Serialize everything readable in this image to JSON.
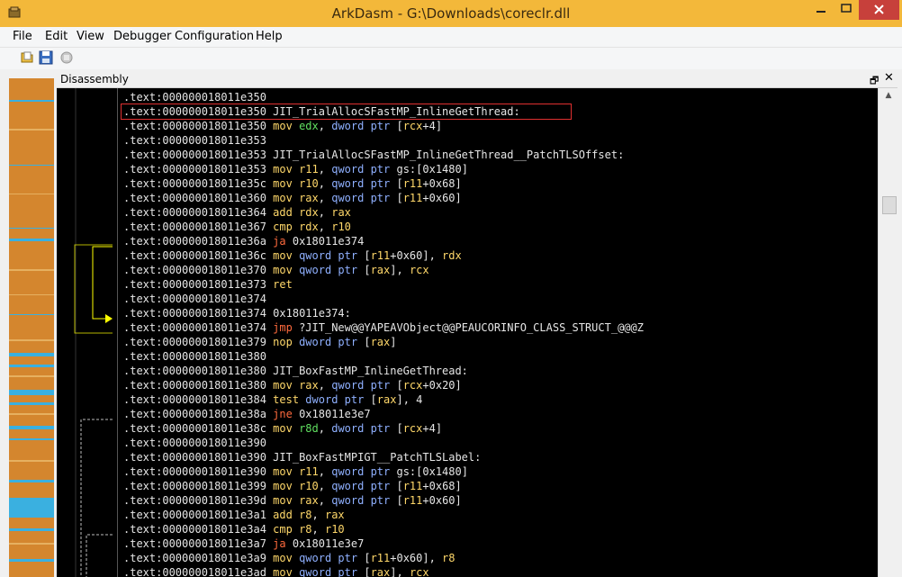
{
  "window": {
    "title": "ArkDasm - G:\\Downloads\\coreclr.dll",
    "minimize_glyph": "—",
    "maximize_glyph": "☐",
    "close_glyph": "✕"
  },
  "menu": {
    "file": "File",
    "edit": "Edit",
    "view": "View",
    "debugger": "Debugger",
    "configuration": "Configuration",
    "help": "Help"
  },
  "toolbar": {
    "icons": [
      "open-icon",
      "save-icon",
      "disabled-icon"
    ]
  },
  "panel": {
    "title": "Disassembly",
    "restore_glyph": "🗗",
    "close_glyph": "✕"
  },
  "colors": {
    "title_bar": "#f3b83a",
    "close_button": "#c7403b",
    "code_background": "#000000",
    "instruction": "#ffd86a",
    "jump": "#ff6a3d",
    "pointer": "#8fb0ff",
    "strip": "#d4862e",
    "strip_accent": "#3ab0e0",
    "highlight_border": "#e03030",
    "graph_arrow": "#ffff00"
  },
  "code_lines": [
    [
      {
        "t": ".text:000000018011e350",
        "c": "addr"
      }
    ],
    [
      {
        "t": ".text:000000018011e350 ",
        "c": "addr"
      },
      {
        "t": "JIT_TrialAllocSFastMP_InlineGetThread:",
        "c": "label"
      }
    ],
    [
      {
        "t": ".text:000000018011e350 ",
        "c": "addr"
      },
      {
        "t": "mov ",
        "c": "instr"
      },
      {
        "t": "edx",
        "c": "green"
      },
      {
        "t": ", ",
        "c": "num"
      },
      {
        "t": "dword ptr ",
        "c": "ptr"
      },
      {
        "t": "[",
        "c": "num"
      },
      {
        "t": "rcx",
        "c": "reg"
      },
      {
        "t": "+4]",
        "c": "num"
      }
    ],
    [
      {
        "t": ".text:000000018011e353",
        "c": "addr"
      }
    ],
    [
      {
        "t": ".text:000000018011e353 ",
        "c": "addr"
      },
      {
        "t": "JIT_TrialAllocSFastMP_InlineGetThread__PatchTLSOffset:",
        "c": "label"
      }
    ],
    [
      {
        "t": ".text:000000018011e353 ",
        "c": "addr"
      },
      {
        "t": "mov ",
        "c": "instr"
      },
      {
        "t": "r11",
        "c": "reg"
      },
      {
        "t": ", ",
        "c": "num"
      },
      {
        "t": "qword ptr ",
        "c": "ptr"
      },
      {
        "t": "gs:[0x1480]",
        "c": "num"
      }
    ],
    [
      {
        "t": ".text:000000018011e35c ",
        "c": "addr"
      },
      {
        "t": "mov ",
        "c": "instr"
      },
      {
        "t": "r10",
        "c": "reg"
      },
      {
        "t": ", ",
        "c": "num"
      },
      {
        "t": "qword ptr ",
        "c": "ptr"
      },
      {
        "t": "[",
        "c": "num"
      },
      {
        "t": "r11",
        "c": "reg"
      },
      {
        "t": "+0x68]",
        "c": "num"
      }
    ],
    [
      {
        "t": ".text:000000018011e360 ",
        "c": "addr"
      },
      {
        "t": "mov ",
        "c": "instr"
      },
      {
        "t": "rax",
        "c": "reg"
      },
      {
        "t": ", ",
        "c": "num"
      },
      {
        "t": "qword ptr ",
        "c": "ptr"
      },
      {
        "t": "[",
        "c": "num"
      },
      {
        "t": "r11",
        "c": "reg"
      },
      {
        "t": "+0x60]",
        "c": "num"
      }
    ],
    [
      {
        "t": ".text:000000018011e364 ",
        "c": "addr"
      },
      {
        "t": "add ",
        "c": "instr"
      },
      {
        "t": "rdx",
        "c": "reg"
      },
      {
        "t": ", ",
        "c": "num"
      },
      {
        "t": "rax",
        "c": "reg"
      }
    ],
    [
      {
        "t": ".text:000000018011e367 ",
        "c": "addr"
      },
      {
        "t": "cmp ",
        "c": "instr"
      },
      {
        "t": "rdx",
        "c": "reg"
      },
      {
        "t": ", ",
        "c": "num"
      },
      {
        "t": "r10",
        "c": "reg"
      }
    ],
    [
      {
        "t": ".text:000000018011e36a ",
        "c": "addr"
      },
      {
        "t": "ja ",
        "c": "jmp"
      },
      {
        "t": "0x18011e374",
        "c": "num"
      }
    ],
    [
      {
        "t": ".text:000000018011e36c ",
        "c": "addr"
      },
      {
        "t": "mov ",
        "c": "instr"
      },
      {
        "t": "qword ptr ",
        "c": "ptr"
      },
      {
        "t": "[",
        "c": "num"
      },
      {
        "t": "r11",
        "c": "reg"
      },
      {
        "t": "+0x60], ",
        "c": "num"
      },
      {
        "t": "rdx",
        "c": "reg"
      }
    ],
    [
      {
        "t": ".text:000000018011e370 ",
        "c": "addr"
      },
      {
        "t": "mov ",
        "c": "instr"
      },
      {
        "t": "qword ptr ",
        "c": "ptr"
      },
      {
        "t": "[",
        "c": "num"
      },
      {
        "t": "rax",
        "c": "reg"
      },
      {
        "t": "], ",
        "c": "num"
      },
      {
        "t": "rcx",
        "c": "reg"
      }
    ],
    [
      {
        "t": ".text:000000018011e373 ",
        "c": "addr"
      },
      {
        "t": "ret",
        "c": "instr"
      }
    ],
    [
      {
        "t": ".text:000000018011e374",
        "c": "addr"
      }
    ],
    [
      {
        "t": ".text:000000018011e374 ",
        "c": "addr"
      },
      {
        "t": "0x18011e374:",
        "c": "label"
      }
    ],
    [
      {
        "t": ".text:000000018011e374 ",
        "c": "addr"
      },
      {
        "t": "jmp ",
        "c": "jmp"
      },
      {
        "t": "?JIT_New@@YAPEAVObject@@PEAUCORINFO_CLASS_STRUCT_@@@Z",
        "c": "label"
      }
    ],
    [
      {
        "t": ".text:000000018011e379 ",
        "c": "addr"
      },
      {
        "t": "nop ",
        "c": "instr"
      },
      {
        "t": "dword ptr ",
        "c": "ptr"
      },
      {
        "t": "[",
        "c": "num"
      },
      {
        "t": "rax",
        "c": "reg"
      },
      {
        "t": "]",
        "c": "num"
      }
    ],
    [
      {
        "t": ".text:000000018011e380",
        "c": "addr"
      }
    ],
    [
      {
        "t": ".text:000000018011e380 ",
        "c": "addr"
      },
      {
        "t": "JIT_BoxFastMP_InlineGetThread:",
        "c": "label"
      }
    ],
    [
      {
        "t": ".text:000000018011e380 ",
        "c": "addr"
      },
      {
        "t": "mov ",
        "c": "instr"
      },
      {
        "t": "rax",
        "c": "reg"
      },
      {
        "t": ", ",
        "c": "num"
      },
      {
        "t": "qword ptr ",
        "c": "ptr"
      },
      {
        "t": "[",
        "c": "num"
      },
      {
        "t": "rcx",
        "c": "reg"
      },
      {
        "t": "+0x20]",
        "c": "num"
      }
    ],
    [
      {
        "t": ".text:000000018011e384 ",
        "c": "addr"
      },
      {
        "t": "test ",
        "c": "instr"
      },
      {
        "t": "dword ptr ",
        "c": "ptr"
      },
      {
        "t": "[",
        "c": "num"
      },
      {
        "t": "rax",
        "c": "reg"
      },
      {
        "t": "], 4",
        "c": "num"
      }
    ],
    [
      {
        "t": ".text:000000018011e38a ",
        "c": "addr"
      },
      {
        "t": "jne ",
        "c": "jmp"
      },
      {
        "t": "0x18011e3e7",
        "c": "num"
      }
    ],
    [
      {
        "t": ".text:000000018011e38c ",
        "c": "addr"
      },
      {
        "t": "mov ",
        "c": "instr"
      },
      {
        "t": "r8d",
        "c": "green"
      },
      {
        "t": ", ",
        "c": "num"
      },
      {
        "t": "dword ptr ",
        "c": "ptr"
      },
      {
        "t": "[",
        "c": "num"
      },
      {
        "t": "rcx",
        "c": "reg"
      },
      {
        "t": "+4]",
        "c": "num"
      }
    ],
    [
      {
        "t": ".text:000000018011e390",
        "c": "addr"
      }
    ],
    [
      {
        "t": ".text:000000018011e390 ",
        "c": "addr"
      },
      {
        "t": "JIT_BoxFastMPIGT__PatchTLSLabel:",
        "c": "label"
      }
    ],
    [
      {
        "t": ".text:000000018011e390 ",
        "c": "addr"
      },
      {
        "t": "mov ",
        "c": "instr"
      },
      {
        "t": "r11",
        "c": "reg"
      },
      {
        "t": ", ",
        "c": "num"
      },
      {
        "t": "qword ptr ",
        "c": "ptr"
      },
      {
        "t": "gs:[0x1480]",
        "c": "num"
      }
    ],
    [
      {
        "t": ".text:000000018011e399 ",
        "c": "addr"
      },
      {
        "t": "mov ",
        "c": "instr"
      },
      {
        "t": "r10",
        "c": "reg"
      },
      {
        "t": ", ",
        "c": "num"
      },
      {
        "t": "qword ptr ",
        "c": "ptr"
      },
      {
        "t": "[",
        "c": "num"
      },
      {
        "t": "r11",
        "c": "reg"
      },
      {
        "t": "+0x68]",
        "c": "num"
      }
    ],
    [
      {
        "t": ".text:000000018011e39d ",
        "c": "addr"
      },
      {
        "t": "mov ",
        "c": "instr"
      },
      {
        "t": "rax",
        "c": "reg"
      },
      {
        "t": ", ",
        "c": "num"
      },
      {
        "t": "qword ptr ",
        "c": "ptr"
      },
      {
        "t": "[",
        "c": "num"
      },
      {
        "t": "r11",
        "c": "reg"
      },
      {
        "t": "+0x60]",
        "c": "num"
      }
    ],
    [
      {
        "t": ".text:000000018011e3a1 ",
        "c": "addr"
      },
      {
        "t": "add ",
        "c": "instr"
      },
      {
        "t": "r8",
        "c": "reg"
      },
      {
        "t": ", ",
        "c": "num"
      },
      {
        "t": "rax",
        "c": "reg"
      }
    ],
    [
      {
        "t": ".text:000000018011e3a4 ",
        "c": "addr"
      },
      {
        "t": "cmp ",
        "c": "instr"
      },
      {
        "t": "r8",
        "c": "reg"
      },
      {
        "t": ", ",
        "c": "num"
      },
      {
        "t": "r10",
        "c": "reg"
      }
    ],
    [
      {
        "t": ".text:000000018011e3a7 ",
        "c": "addr"
      },
      {
        "t": "ja ",
        "c": "jmp"
      },
      {
        "t": "0x18011e3e7",
        "c": "num"
      }
    ],
    [
      {
        "t": ".text:000000018011e3a9 ",
        "c": "addr"
      },
      {
        "t": "mov ",
        "c": "instr"
      },
      {
        "t": "qword ptr ",
        "c": "ptr"
      },
      {
        "t": "[",
        "c": "num"
      },
      {
        "t": "r11",
        "c": "reg"
      },
      {
        "t": "+0x60], ",
        "c": "num"
      },
      {
        "t": "r8",
        "c": "reg"
      }
    ],
    [
      {
        "t": ".text:000000018011e3ad ",
        "c": "addr"
      },
      {
        "t": "mov ",
        "c": "instr"
      },
      {
        "t": "qword ptr ",
        "c": "ptr"
      },
      {
        "t": "[",
        "c": "num"
      },
      {
        "t": "rax",
        "c": "reg"
      },
      {
        "t": "], ",
        "c": "num"
      },
      {
        "t": "rcx",
        "c": "reg"
      }
    ]
  ]
}
